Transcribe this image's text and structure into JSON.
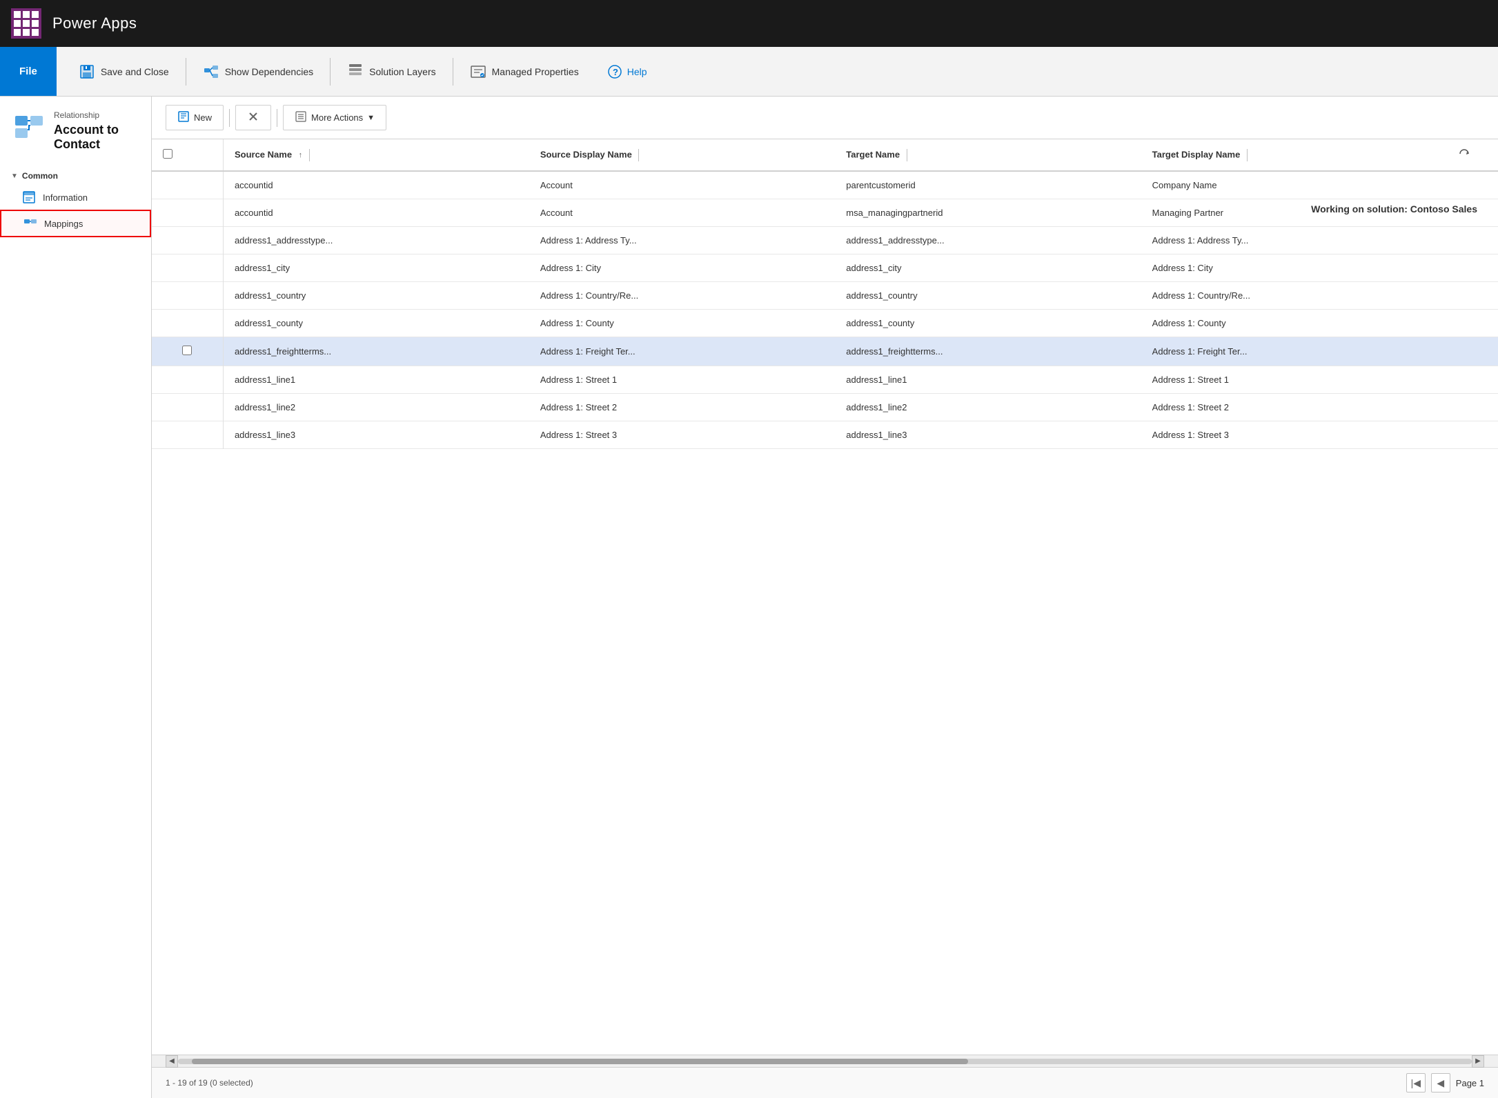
{
  "app": {
    "title": "Power Apps"
  },
  "ribbon": {
    "file_label": "File",
    "save_close_label": "Save and Close",
    "show_dependencies_label": "Show Dependencies",
    "solution_layers_label": "Solution Layers",
    "managed_properties_label": "Managed Properties",
    "help_label": "Help"
  },
  "entity_header": {
    "label": "Relationship",
    "title": "Account to Contact",
    "solution_banner": "Working on solution: Contoso Sales"
  },
  "nav": {
    "section_label": "Common",
    "items": [
      {
        "id": "information",
        "label": "Information",
        "selected": false
      },
      {
        "id": "mappings",
        "label": "Mappings",
        "selected": true
      }
    ]
  },
  "toolbar": {
    "new_label": "New",
    "delete_label": "",
    "more_actions_label": "More Actions"
  },
  "table": {
    "columns": [
      {
        "id": "source-name",
        "label": "Source Name",
        "sortable": true,
        "sort_dir": "asc"
      },
      {
        "id": "source-display",
        "label": "Source Display Name",
        "sortable": false
      },
      {
        "id": "target-name",
        "label": "Target Name",
        "sortable": false
      },
      {
        "id": "target-display",
        "label": "Target Display Name",
        "sortable": false
      }
    ],
    "rows": [
      {
        "id": 1,
        "source_name": "accountid",
        "source_display": "Account",
        "target_name": "parentcustomerid",
        "target_display": "Company Name",
        "highlighted": false
      },
      {
        "id": 2,
        "source_name": "accountid",
        "source_display": "Account",
        "target_name": "msa_managingpartnerid",
        "target_display": "Managing Partner",
        "highlighted": false
      },
      {
        "id": 3,
        "source_name": "address1_addresstype...",
        "source_display": "Address 1: Address Ty...",
        "target_name": "address1_addresstype...",
        "target_display": "Address 1: Address Ty...",
        "highlighted": false
      },
      {
        "id": 4,
        "source_name": "address1_city",
        "source_display": "Address 1: City",
        "target_name": "address1_city",
        "target_display": "Address 1: City",
        "highlighted": false
      },
      {
        "id": 5,
        "source_name": "address1_country",
        "source_display": "Address 1: Country/Re...",
        "target_name": "address1_country",
        "target_display": "Address 1: Country/Re...",
        "highlighted": false
      },
      {
        "id": 6,
        "source_name": "address1_county",
        "source_display": "Address 1: County",
        "target_name": "address1_county",
        "target_display": "Address 1: County",
        "highlighted": false
      },
      {
        "id": 7,
        "source_name": "address1_freightterms...",
        "source_display": "Address 1: Freight Ter...",
        "target_name": "address1_freightterms...",
        "target_display": "Address 1: Freight Ter...",
        "highlighted": true
      },
      {
        "id": 8,
        "source_name": "address1_line1",
        "source_display": "Address 1: Street 1",
        "target_name": "address1_line1",
        "target_display": "Address 1: Street 1",
        "highlighted": false
      },
      {
        "id": 9,
        "source_name": "address1_line2",
        "source_display": "Address 1: Street 2",
        "target_name": "address1_line2",
        "target_display": "Address 1: Street 2",
        "highlighted": false
      },
      {
        "id": 10,
        "source_name": "address1_line3",
        "source_display": "Address 1: Street 3",
        "target_name": "address1_line3",
        "target_display": "Address 1: Street 3",
        "highlighted": false
      }
    ]
  },
  "status": {
    "record_count": "1 - 19 of 19 (0 selected)",
    "page_label": "Page 1"
  }
}
